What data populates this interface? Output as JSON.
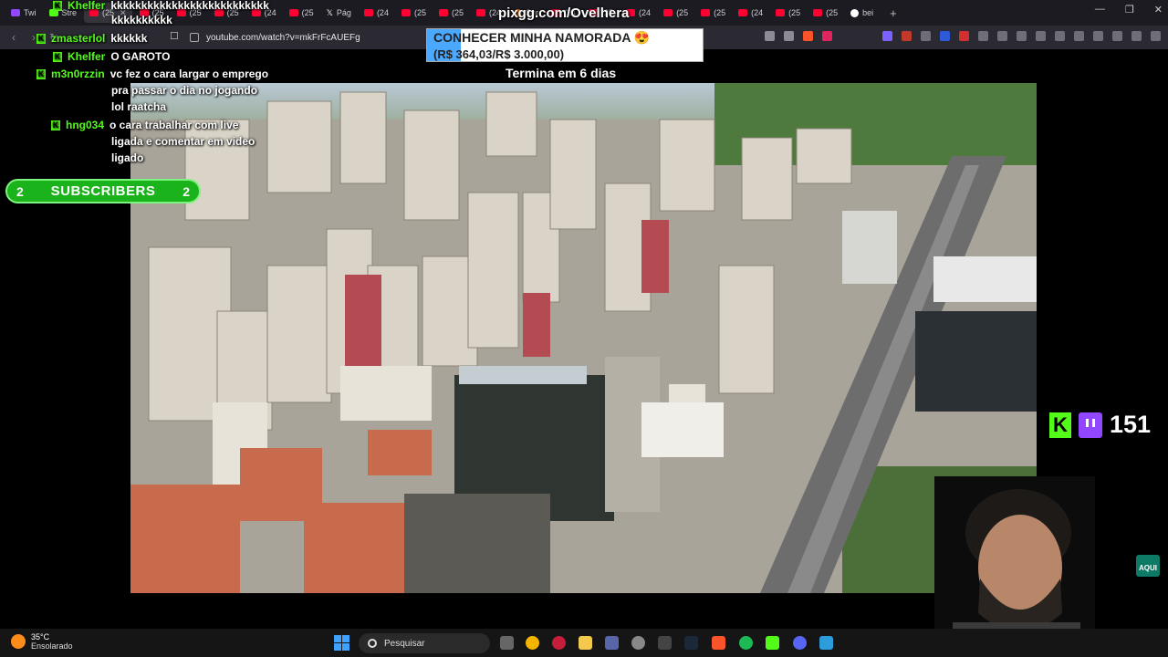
{
  "browser": {
    "tabs": [
      {
        "label": "Twi",
        "icon": "twitch-icon"
      },
      {
        "label": "Stre",
        "icon": "kick-icon"
      },
      {
        "label": "(25",
        "icon": "youtube-icon"
      },
      {
        "label": "(25",
        "icon": "youtube-icon"
      },
      {
        "label": "(25",
        "icon": "youtube-icon"
      },
      {
        "label": "(25",
        "icon": "youtube-icon"
      },
      {
        "label": "(24",
        "icon": "youtube-icon"
      },
      {
        "label": "(25",
        "icon": "youtube-icon"
      },
      {
        "label": "Pág",
        "icon": "x-icon"
      },
      {
        "label": "(24",
        "icon": "youtube-icon"
      },
      {
        "label": "(25",
        "icon": "youtube-icon"
      },
      {
        "label": "(25",
        "icon": "youtube-icon"
      },
      {
        "label": "(24",
        "icon": "youtube-icon"
      },
      {
        "label": "Sor",
        "icon": "sr-icon"
      },
      {
        "label": "(24",
        "icon": "youtube-icon"
      },
      {
        "label": "(25",
        "icon": "youtube-icon"
      },
      {
        "label": "(24",
        "icon": "youtube-icon"
      },
      {
        "label": "(25",
        "icon": "youtube-icon"
      },
      {
        "label": "(25",
        "icon": "youtube-icon"
      },
      {
        "label": "(24",
        "icon": "youtube-icon"
      },
      {
        "label": "(25",
        "icon": "youtube-icon"
      },
      {
        "label": "(25",
        "icon": "youtube-icon"
      },
      {
        "label": "bei",
        "icon": "google-icon"
      }
    ],
    "url": "youtube.com/watch?v=mkFrFcAUEFg"
  },
  "overlay": {
    "pix_title": "pixgg.com/Ovelhera",
    "goal_title": "CONHECER MINHA NAMORADA 😍",
    "goal_amount": "(R$ 364,03/R$ 3.000,00)",
    "goal_progress": 0.1213,
    "goal_ends": "Termina em 6 dias"
  },
  "chat": [
    {
      "user": "Khelfer",
      "message": "kkkkkkkkkkkkkkkkkkkkkkkkkk"
    },
    {
      "user": "",
      "message": "kkkkkkkkkk"
    },
    {
      "user": "zmasterlol",
      "message": "kkkkkk"
    },
    {
      "user": "Khelfer",
      "message": "O GAROTO"
    },
    {
      "user": "m3n0rzzin",
      "message": "vc fez o cara largar o emprego"
    },
    {
      "user": "",
      "message": "pra passar o dia no jogando"
    },
    {
      "user": "",
      "message": "lol raatcha"
    },
    {
      "user": "hng034",
      "message": "o cara trabalhar com live"
    },
    {
      "user": "",
      "message": "ligada e comentar em video"
    },
    {
      "user": "",
      "message": "ligado"
    }
  ],
  "subscribers": {
    "left": "2",
    "label": "SUBSCRIBERS",
    "right": "2"
  },
  "viewers": {
    "count": "151"
  },
  "taskbar": {
    "weather_temp": "35°C",
    "weather_cond": "Ensolarado",
    "search_placeholder": "Pesquisar"
  },
  "colors": {
    "kick_green": "#53fc18",
    "twitch_purple": "#9146ff",
    "youtube_red": "#ff0033"
  }
}
